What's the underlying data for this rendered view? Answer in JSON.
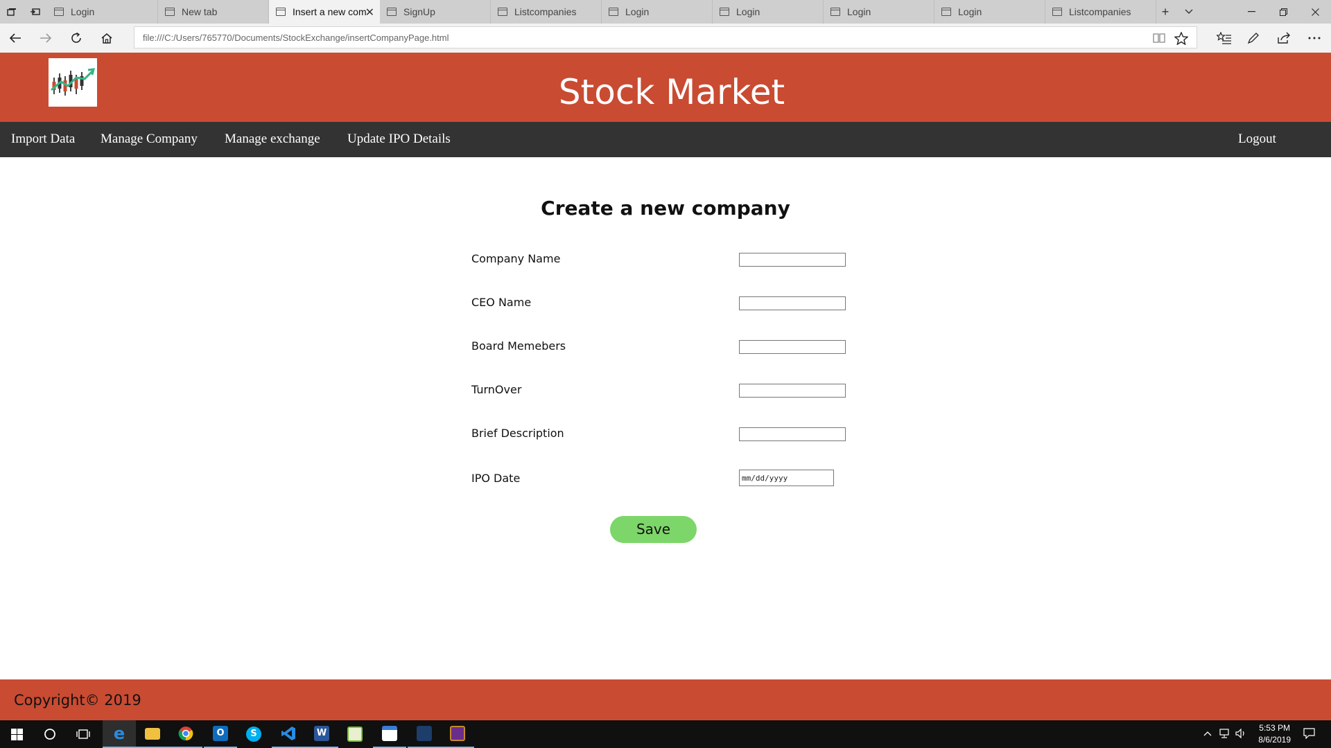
{
  "browser": {
    "tabs": [
      {
        "label": "Login",
        "active": false
      },
      {
        "label": "New tab",
        "active": false
      },
      {
        "label": "Insert a new com",
        "active": true
      },
      {
        "label": "SignUp",
        "active": false
      },
      {
        "label": "Listcompanies",
        "active": false
      },
      {
        "label": "Login",
        "active": false
      },
      {
        "label": "Login",
        "active": false
      },
      {
        "label": "Login",
        "active": false
      },
      {
        "label": "Login",
        "active": false
      },
      {
        "label": "Listcompanies",
        "active": false
      }
    ],
    "address": "file:///C:/Users/765770/Documents/StockExchange/insertCompanyPage.html"
  },
  "header": {
    "title": "Stock Market"
  },
  "menu": {
    "items": [
      "Import Data",
      "Manage Company",
      "Manage exchange",
      "Update IPO Details"
    ],
    "logout": "Logout"
  },
  "form": {
    "heading": "Create a new company",
    "fields": [
      {
        "label": "Company Name",
        "value": ""
      },
      {
        "label": "CEO Name",
        "value": ""
      },
      {
        "label": "Board Memebers",
        "value": ""
      },
      {
        "label": "TurnOver",
        "value": ""
      },
      {
        "label": "Brief Description",
        "value": ""
      }
    ],
    "ipo_date": {
      "label": "IPO Date",
      "placeholder": "mm/dd/yyyy"
    },
    "save_label": "Save"
  },
  "footer": {
    "copyright": "Copyright© 2019"
  },
  "taskbar": {
    "time": "5:53 PM",
    "date": "8/6/2019"
  },
  "colors": {
    "brand": "#c94b32",
    "menu_bg": "#333333",
    "save_button": "#7dd669"
  }
}
